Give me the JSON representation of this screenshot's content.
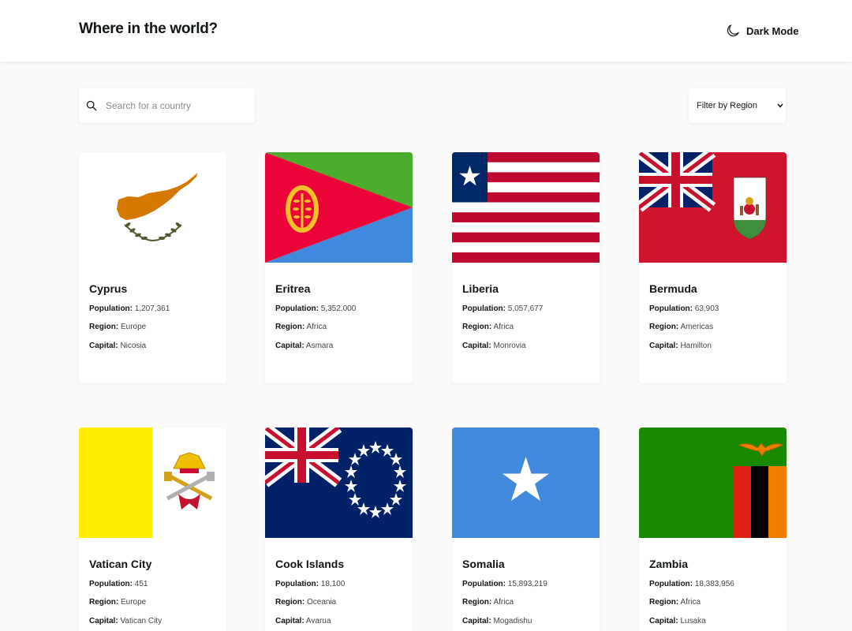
{
  "header": {
    "title": "Where in the world?",
    "theme_toggle": {
      "label": "Dark Mode",
      "icon": "moon-icon"
    }
  },
  "controls": {
    "search": {
      "placeholder": "Search for a country",
      "value": "",
      "icon": "search-icon"
    },
    "filter": {
      "selected": "Filter by Region",
      "icon": "chevron-down-icon"
    }
  },
  "labels": {
    "population": "Population:",
    "region": "Region:",
    "capital": "Capital:"
  },
  "countries": [
    {
      "name": "Cyprus",
      "population": "1,207,361",
      "region": "Europe",
      "capital": "Nicosia"
    },
    {
      "name": "Eritrea",
      "population": "5,352,000",
      "region": "Africa",
      "capital": "Asmara"
    },
    {
      "name": "Liberia",
      "population": "5,057,677",
      "region": "Africa",
      "capital": "Monrovia"
    },
    {
      "name": "Bermuda",
      "population": "63,903",
      "region": "Americas",
      "capital": "Hamilton"
    },
    {
      "name": "Vatican City",
      "population": "451",
      "region": "Europe",
      "capital": "Vatican City"
    },
    {
      "name": "Cook Islands",
      "population": "18,100",
      "region": "Oceania",
      "capital": "Avarua"
    },
    {
      "name": "Somalia",
      "population": "15,893,219",
      "region": "Africa",
      "capital": "Mogadishu"
    },
    {
      "name": "Zambia",
      "population": "18,383,956",
      "region": "Africa",
      "capital": "Lusaka"
    }
  ],
  "colors": {
    "background": "#fafafa",
    "card": "#ffffff",
    "text": "#111517"
  }
}
